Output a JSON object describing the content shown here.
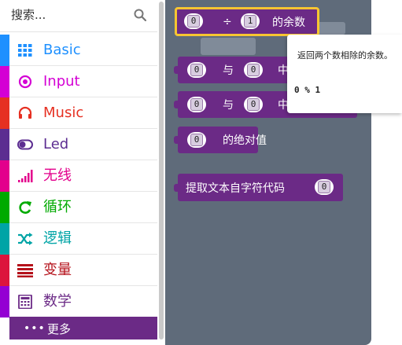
{
  "search": {
    "placeholder": "搜索..."
  },
  "categories": [
    {
      "label": "Basic",
      "color": "#1e90ff",
      "icon": "grid-icon"
    },
    {
      "label": "Input",
      "color": "#d400d4",
      "icon": "radio-target-icon"
    },
    {
      "label": "Music",
      "color": "#e63022",
      "icon": "headphones-icon"
    },
    {
      "label": "Led",
      "color": "#5c2d91",
      "icon": "toggle-icon"
    },
    {
      "label": "无线",
      "color": "#e3008c",
      "icon": "signal-bars-icon"
    },
    {
      "label": "循环",
      "color": "#00aa00",
      "icon": "refresh-icon"
    },
    {
      "label": "逻辑",
      "color": "#00a4a6",
      "icon": "shuffle-icon"
    },
    {
      "label": "变量",
      "color": "#dc143c",
      "icon": "list-lines-icon"
    },
    {
      "label": "数学",
      "color": "#9400d3",
      "icon": "calculator-icon"
    }
  ],
  "more": {
    "label": "更多",
    "dots": "•••"
  },
  "blocks": {
    "divide": {
      "a": "0",
      "op": "÷",
      "b": "1",
      "suffix": "的余数"
    },
    "min": {
      "a": "0",
      "conj": "与",
      "b": "0",
      "suffix": "中"
    },
    "max": {
      "a": "0",
      "conj": "与",
      "b": "0",
      "suffix": "中"
    },
    "abs": {
      "a": "0",
      "suffix": "的绝对值"
    },
    "charcode": {
      "label": "提取文本自字符代码",
      "a": "0"
    }
  },
  "tooltip": {
    "text": "返回两个数相除的余数。",
    "code": "0 % 1"
  },
  "colors": {
    "math_block": "#6b2a86",
    "flyout_bg": "#5f6b7a",
    "highlight": "#f7c531"
  }
}
